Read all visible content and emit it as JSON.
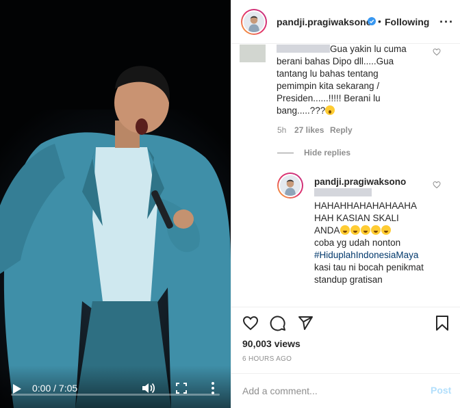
{
  "video": {
    "time_display": "0:00 / 7:05",
    "progress": 0.0
  },
  "header": {
    "username": "pandji.pragiwaksono",
    "separator": "•",
    "follow_status": "Following",
    "more_label": "···"
  },
  "comments": {
    "first": {
      "text": "Gua yakin lu cuma berani bahas Dipo dll.....Gua tantang lu bahas tentang pemimpin kita sekarang / Presiden......!!!!! Berani lu bang.....???",
      "age": "5h",
      "likes": "27 likes",
      "reply_label": "Reply"
    },
    "hide_replies": "Hide replies",
    "reply": {
      "username": "pandji.pragiwaksono",
      "text_line1": "HAHAHHAHAHAHAAHA HAH KASIAN SKALI ANDA",
      "text_line2": "coba yg udah nonton",
      "hashtag": "#HiduplahIndonesiaMaya",
      "text_line3": "kasi tau ni bocah penikmat standup gratisan"
    }
  },
  "stats": {
    "views": "90,003 views",
    "posted_ago": "6 HOURS AGO"
  },
  "composer": {
    "placeholder": "Add a comment...",
    "post_label": "Post"
  },
  "colors": {
    "link": "#00376b",
    "muted": "#8e8e8e",
    "post_disabled": "#b2dffc",
    "verified": "#3897f0"
  }
}
